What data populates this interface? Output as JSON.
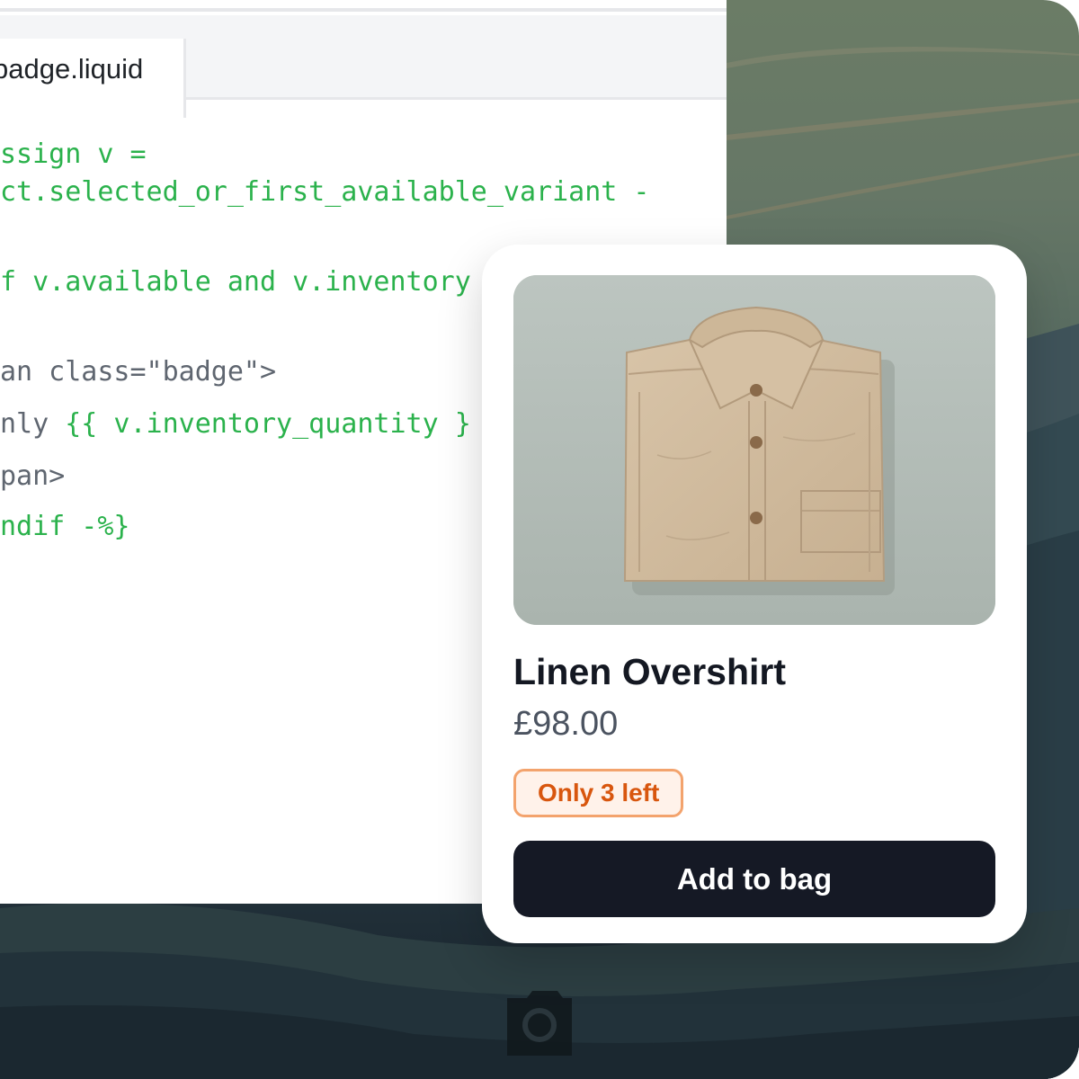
{
  "editor": {
    "tab_label": "badge.liquid",
    "code_lines": [
      [
        {
          "t": "ssign v =",
          "c": "green"
        }
      ],
      [
        {
          "t": "ct.selected_or_first_available_variant -",
          "c": "green"
        }
      ],
      [
        {
          "t": "f v.available and v.inventory",
          "c": "green"
        }
      ],
      [
        {
          "t": "an class=\"badge\">",
          "c": "gray"
        }
      ],
      [
        {
          "t": "nly ",
          "c": "gray"
        },
        {
          "t": "{{ v.inventory_quantity }",
          "c": "green"
        }
      ],
      [
        {
          "t": "pan>",
          "c": "gray"
        }
      ],
      [
        {
          "t": "ndif -%}",
          "c": "green"
        }
      ]
    ]
  },
  "product": {
    "title": "Linen Overshirt",
    "price": "£98.00",
    "stock_badge": "Only 3 left",
    "add_button_label": "Add to bag",
    "image_icon": "linen-shirt-photo"
  },
  "colors": {
    "code_green": "#2bb24c",
    "code_gray": "#5f6670",
    "badge_text": "#d8560e",
    "badge_border": "#f3a36d",
    "badge_bg": "#fff2ea",
    "button_bg": "#151925"
  }
}
